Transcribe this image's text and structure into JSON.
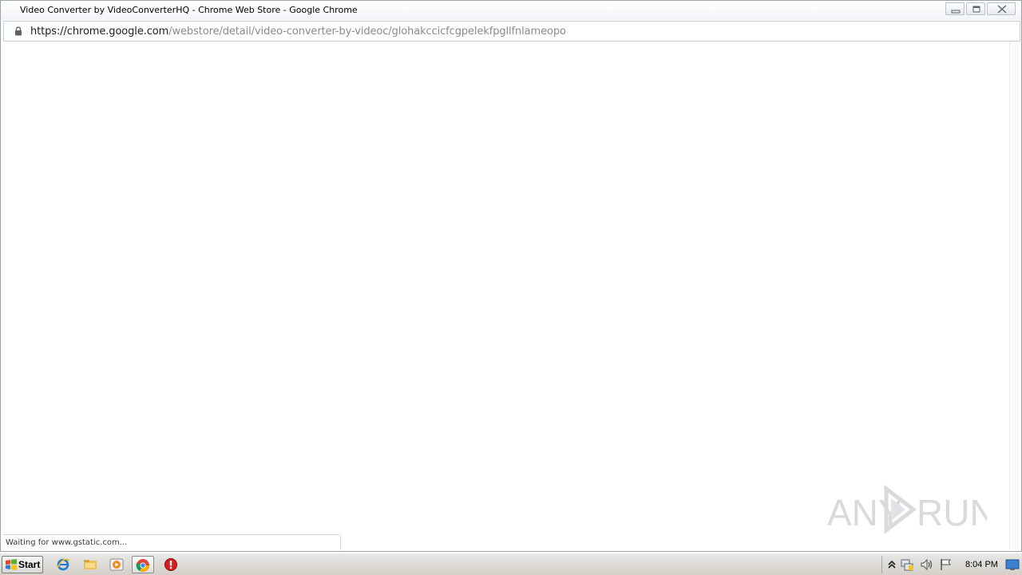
{
  "window": {
    "title": "Video Converter by VideoConverterHQ - Chrome Web Store - Google Chrome"
  },
  "address_bar": {
    "host": "https://chrome.google.com",
    "path": "/webstore/detail/video-converter-by-videoc/glohakccicfcgpelekfpgllfnlameopo"
  },
  "status": {
    "text": "Waiting for www.gstatic.com..."
  },
  "watermark": {
    "text_left": "ANY",
    "text_right": "RUN"
  },
  "taskbar": {
    "start_label": "Start",
    "clock": "8:04 PM",
    "pinned": [
      "ie-icon",
      "explorer-icon",
      "media-player-icon",
      "chrome-icon",
      "stop-icon"
    ]
  },
  "colors": {
    "taskbar_bg": "#d4d0c8",
    "url_host": "#202020",
    "url_path": "#8a8a8a"
  }
}
